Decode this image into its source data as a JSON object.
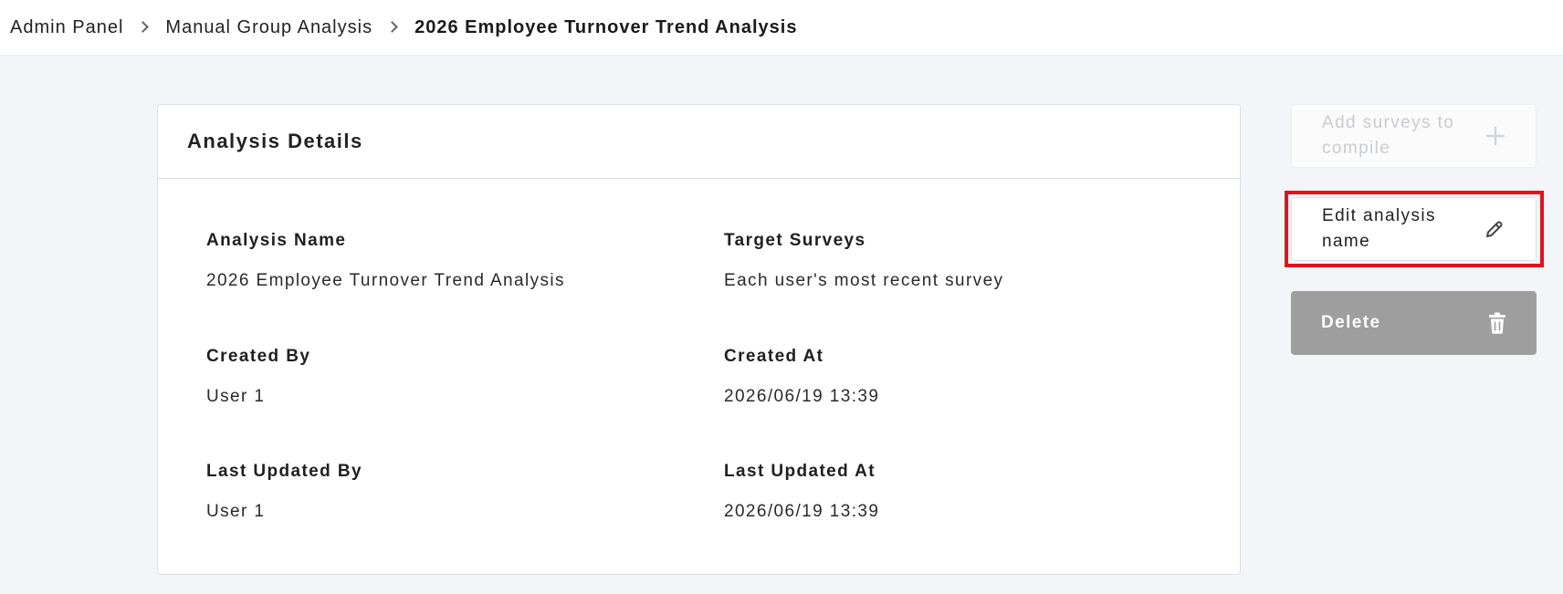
{
  "breadcrumb": {
    "items": [
      "Admin Panel",
      "Manual Group Analysis",
      "2026 Employee Turnover Trend Analysis"
    ]
  },
  "card": {
    "title": "Analysis Details",
    "fields": {
      "analysis_name": {
        "label": "Analysis Name",
        "value": "2026 Employee Turnover Trend Analysis"
      },
      "target_surveys": {
        "label": "Target Surveys",
        "value": "Each user's most recent survey"
      },
      "created_by": {
        "label": "Created By",
        "value": "User 1"
      },
      "created_at": {
        "label": "Created At",
        "value": "2026/06/19 13:39"
      },
      "last_updated_by": {
        "label": "Last Updated By",
        "value": "User 1"
      },
      "last_updated_at": {
        "label": "Last Updated At",
        "value": "2026/06/19 13:39"
      }
    }
  },
  "actions": {
    "add_surveys": {
      "label": "Add surveys to compile",
      "icon": "plus-icon",
      "state": "disabled"
    },
    "edit_name": {
      "label": "Edit analysis name",
      "icon": "pencil-icon"
    },
    "delete": {
      "label": "Delete",
      "icon": "trash-icon"
    }
  },
  "colors": {
    "background": "#f4f5f8",
    "highlight": "#e3121b",
    "delete_button": "#9e9e9e",
    "disabled_text": "#c9cbd0"
  }
}
